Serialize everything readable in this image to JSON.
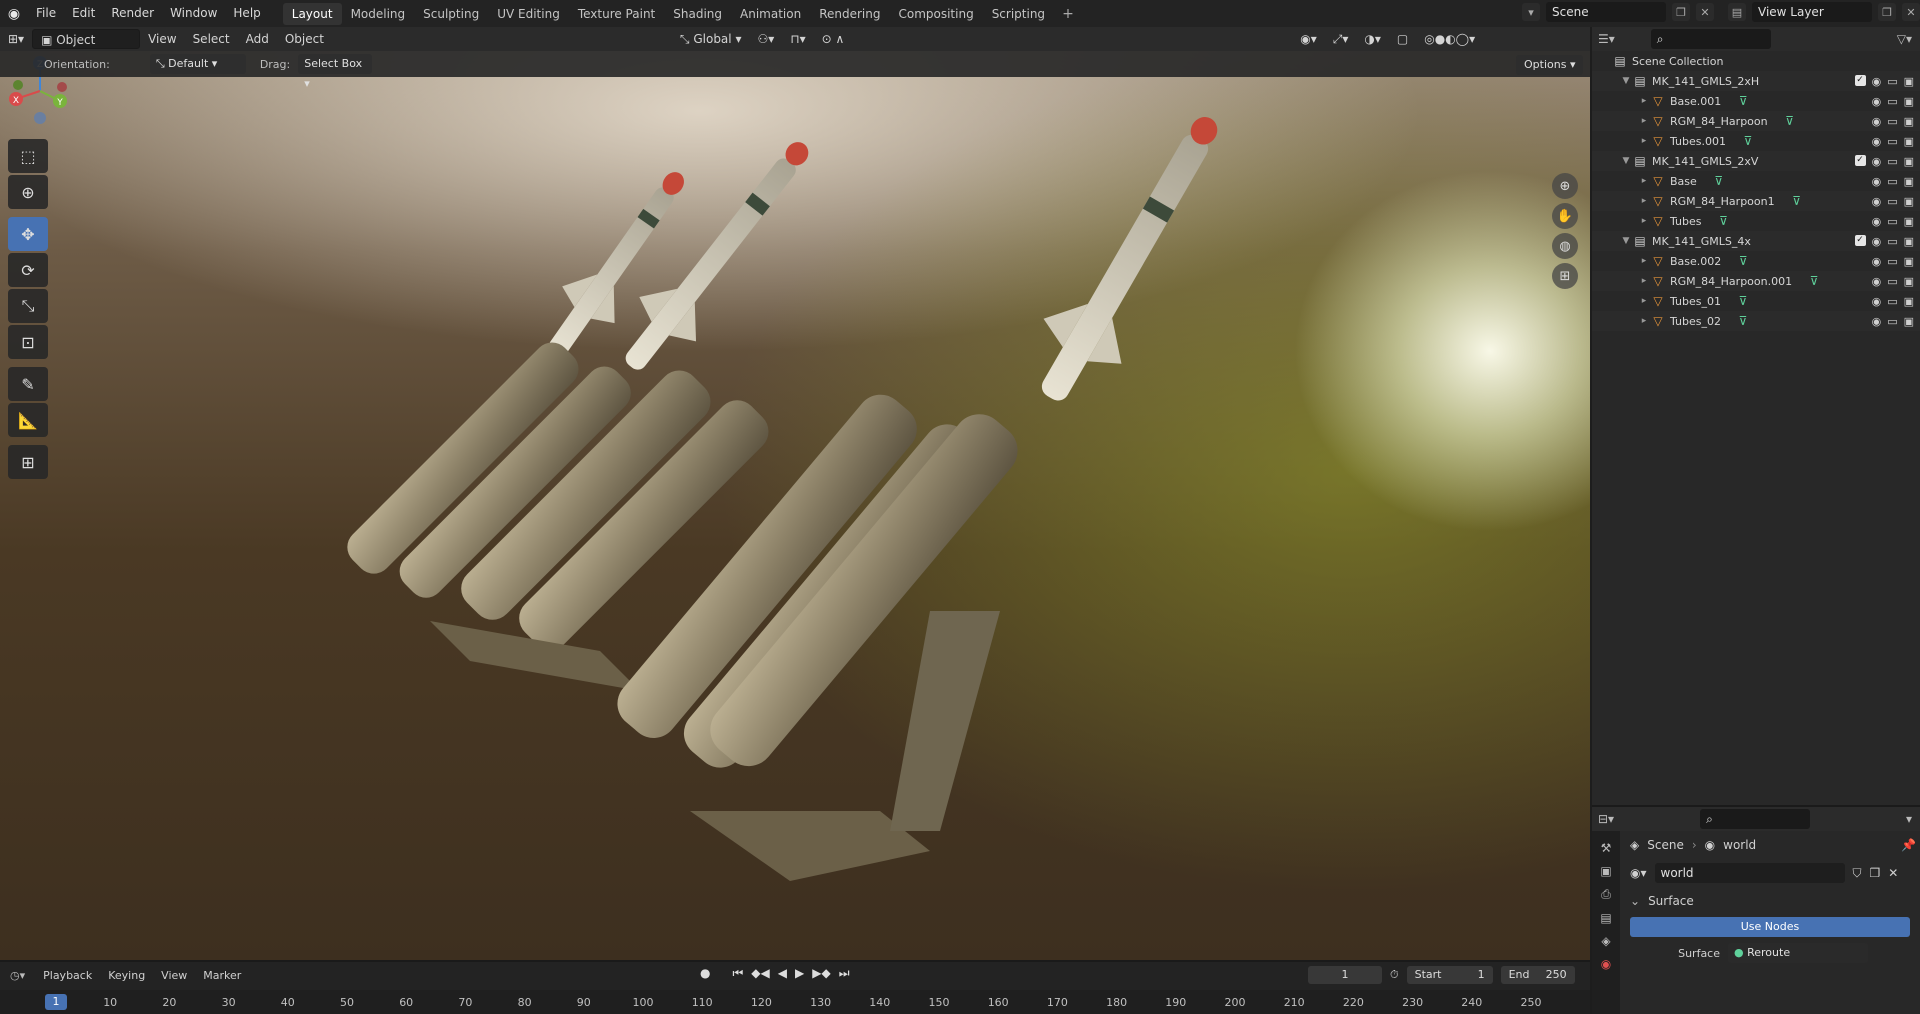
{
  "menu": {
    "items": [
      "File",
      "Edit",
      "Render",
      "Window",
      "Help"
    ]
  },
  "workspaces": {
    "tabs": [
      "Layout",
      "Modeling",
      "Sculpting",
      "UV Editing",
      "Texture Paint",
      "Shading",
      "Animation",
      "Rendering",
      "Compositing",
      "Scripting"
    ],
    "active": "Layout"
  },
  "scene": {
    "name": "Scene",
    "view_layer": "View Layer"
  },
  "viewport_header": {
    "mode": "Object Mode",
    "menus": [
      "View",
      "Select",
      "Add",
      "Object"
    ],
    "transform_orientation": "Global",
    "orientation_label": "Orientation:",
    "orientation_value": "Default",
    "drag_label": "Drag:",
    "drag_value": "Select Box",
    "options": "Options"
  },
  "gizmo": {
    "x": "X",
    "y": "Y",
    "z": "Z"
  },
  "outliner": {
    "title": "Scene Collection",
    "rows": [
      {
        "name": "MK_141_GMLS_2xH",
        "kind": "collection"
      },
      {
        "name": "Base.001",
        "kind": "object"
      },
      {
        "name": "RGM_84_Harpoon",
        "kind": "object"
      },
      {
        "name": "Tubes.001",
        "kind": "object"
      },
      {
        "name": "MK_141_GMLS_2xV",
        "kind": "collection"
      },
      {
        "name": "Base",
        "kind": "object"
      },
      {
        "name": "RGM_84_Harpoon1",
        "kind": "object"
      },
      {
        "name": "Tubes",
        "kind": "object"
      },
      {
        "name": "MK_141_GMLS_4x",
        "kind": "collection"
      },
      {
        "name": "Base.002",
        "kind": "object"
      },
      {
        "name": "RGM_84_Harpoon.001",
        "kind": "object"
      },
      {
        "name": "Tubes_01",
        "kind": "object"
      },
      {
        "name": "Tubes_02",
        "kind": "object"
      }
    ]
  },
  "properties": {
    "breadcrumb_scene": "Scene",
    "breadcrumb_world": "world",
    "world_name": "world",
    "panel": "Surface",
    "use_nodes": "Use Nodes",
    "surface_label": "Surface",
    "surface_value": "Reroute"
  },
  "timeline": {
    "menus": [
      "Playback",
      "Keying",
      "View",
      "Marker"
    ],
    "current_frame": "1",
    "start_label": "Start",
    "start": "1",
    "end_label": "End",
    "end": "250",
    "ticks": [
      "10",
      "20",
      "30",
      "40",
      "50",
      "60",
      "70",
      "80",
      "90",
      "100",
      "110",
      "120",
      "130",
      "140",
      "150",
      "160",
      "170",
      "180",
      "190",
      "200",
      "210",
      "220",
      "230",
      "240",
      "250"
    ]
  }
}
